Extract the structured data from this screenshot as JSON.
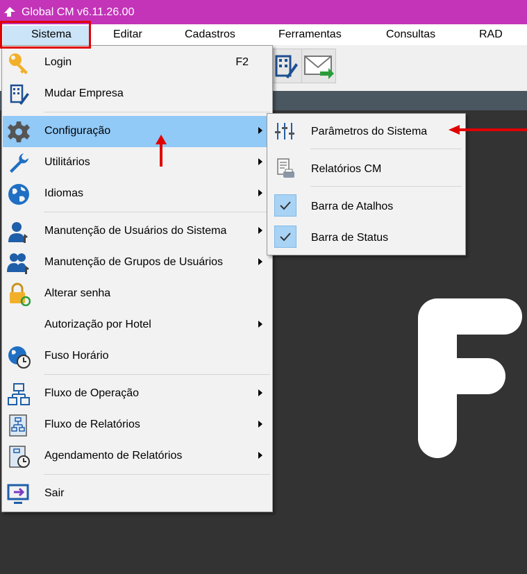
{
  "window": {
    "title": "Global CM v6.11.26.00"
  },
  "menubar": {
    "items": [
      {
        "label": "Sistema"
      },
      {
        "label": "Editar"
      },
      {
        "label": "Cadastros"
      },
      {
        "label": "Ferramentas"
      },
      {
        "label": "Consultas"
      },
      {
        "label": "RAD"
      }
    ]
  },
  "sistema_menu": {
    "items": [
      {
        "label": "Login",
        "shortcut": "F2"
      },
      {
        "label": "Mudar Empresa"
      },
      {
        "label": "Configuração"
      },
      {
        "label": "Utilitários"
      },
      {
        "label": "Idiomas"
      },
      {
        "label": "Manutenção de Usuários do Sistema"
      },
      {
        "label": "Manutenção de Grupos de Usuários"
      },
      {
        "label": "Alterar senha"
      },
      {
        "label": "Autorização por Hotel"
      },
      {
        "label": "Fuso Horário"
      },
      {
        "label": "Fluxo de Operação"
      },
      {
        "label": "Fluxo de Relatórios"
      },
      {
        "label": "Agendamento de Relatórios"
      },
      {
        "label": "Sair"
      }
    ]
  },
  "config_submenu": {
    "items": [
      {
        "label": "Parâmetros do Sistema"
      },
      {
        "label": "Relatórios CM"
      },
      {
        "label": "Barra de Atalhos",
        "checked": true
      },
      {
        "label": "Barra de Status",
        "checked": true
      }
    ]
  },
  "colors": {
    "titlebar": "#c334b8",
    "highlight": "#91c9f7",
    "annotation": "#e10000",
    "workspace": "#333333"
  }
}
